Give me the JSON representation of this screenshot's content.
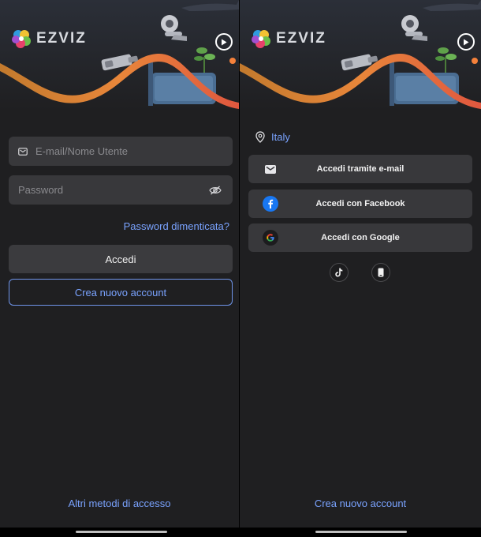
{
  "brand": {
    "name": "EZVIZ"
  },
  "login_screen": {
    "email_placeholder": "E-mail/Nome Utente",
    "password_placeholder": "Password",
    "forgot_password": "Password dimenticata?",
    "login_button": "Accedi",
    "create_account_button": "Crea nuovo account",
    "other_methods_link": "Altri metodi di accesso"
  },
  "methods_screen": {
    "country": "Italy",
    "email_button": "Accedi tramite e-mail",
    "facebook_button": "Accedi con Facebook",
    "google_button": "Accedi con Google",
    "create_account_link": "Crea nuovo account"
  },
  "colors": {
    "background": "#1f1f21",
    "field": "#38383b",
    "accent_link": "#7aa3ff",
    "wave_orange": "#f5813b",
    "facebook_blue": "#1877f2"
  },
  "icons": [
    "mail-icon",
    "eye-off-icon",
    "play-icon",
    "location-pin-icon",
    "facebook-icon",
    "google-icon",
    "tiktok-icon",
    "phone-icon"
  ]
}
